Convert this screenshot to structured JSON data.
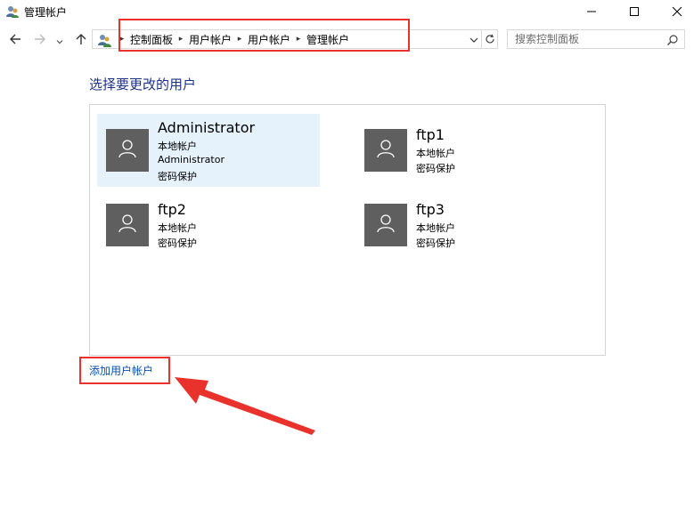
{
  "window": {
    "title": "管理帐户"
  },
  "address_bar": {
    "breadcrumbs": [
      "控制面板",
      "用户帐户",
      "用户帐户",
      "管理帐户"
    ]
  },
  "search": {
    "placeholder": "搜索控制面板"
  },
  "main": {
    "heading": "选择要更改的用户",
    "users": [
      {
        "name": "Administrator",
        "lines": [
          "本地帐户",
          "Administrator",
          "密码保护"
        ],
        "selected": true
      },
      {
        "name": "ftp1",
        "lines": [
          "本地帐户",
          "密码保护"
        ],
        "selected": false
      },
      {
        "name": "ftp2",
        "lines": [
          "本地帐户",
          "密码保护"
        ],
        "selected": false
      },
      {
        "name": "ftp3",
        "lines": [
          "本地帐户",
          "密码保护"
        ],
        "selected": false
      }
    ],
    "add_user_link": "添加用户帐户"
  },
  "colors": {
    "accent_link": "#0b4ea2",
    "heading": "#1e3287",
    "annotation_red": "#e8322b",
    "selected_bg": "#e5f1fb",
    "avatar_bg": "#5f5f5f"
  }
}
